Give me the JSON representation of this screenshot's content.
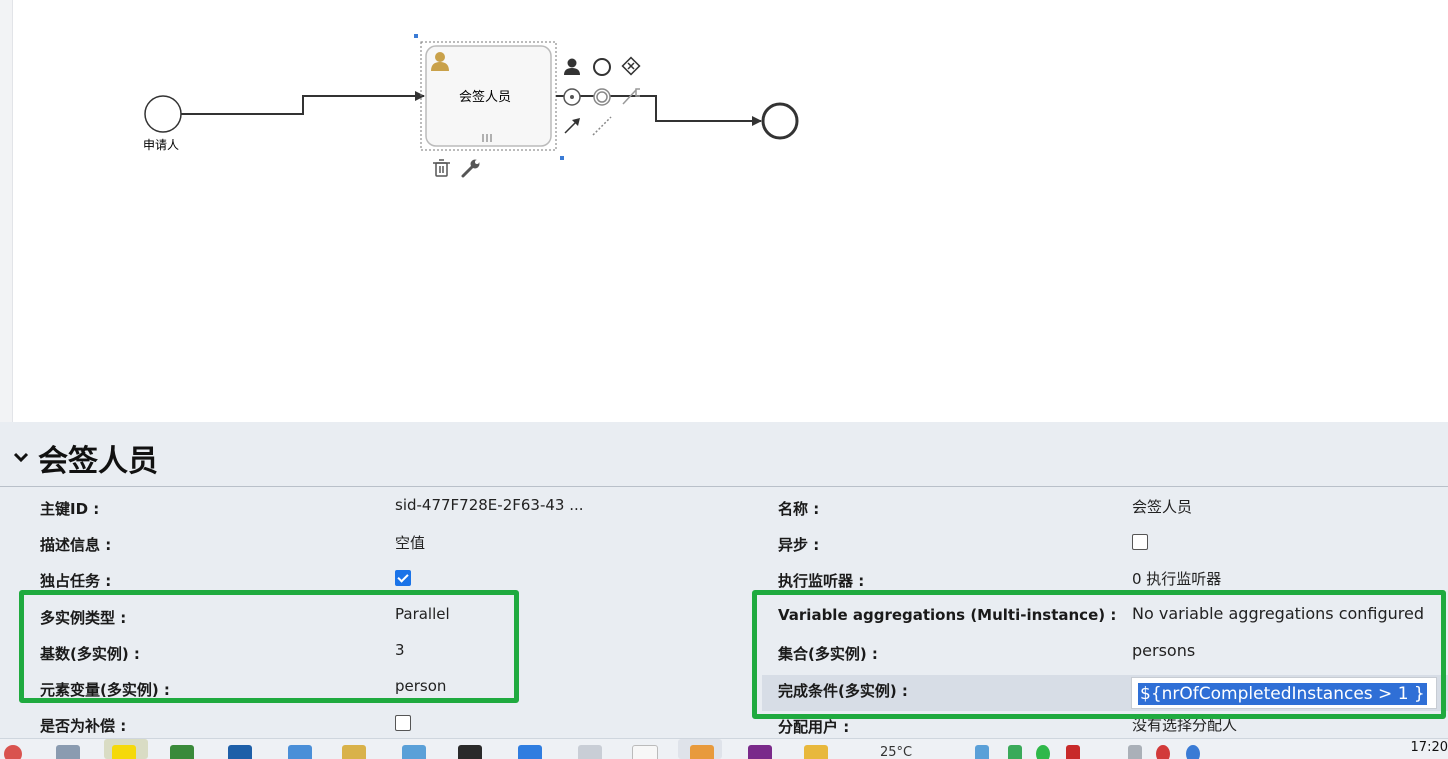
{
  "diagram": {
    "start_label": "申请人",
    "task_label": "会签人员"
  },
  "props": {
    "title": "会签人员",
    "left": [
      {
        "label": "主键ID :",
        "value": "sid-477F728E-2F63-43 ..."
      },
      {
        "label": "描述信息 :",
        "value": "空值"
      },
      {
        "label": "独占任务 :",
        "checked": true
      },
      {
        "label": "多实例类型 :",
        "value": "Parallel"
      },
      {
        "label": "基数(多实例) :",
        "value": "3"
      },
      {
        "label": "元素变量(多实例) :",
        "value": "person"
      },
      {
        "label": "是否为补偿 :",
        "checked": false
      }
    ],
    "right": [
      {
        "label": "名称 :",
        "value": "会签人员"
      },
      {
        "label": "异步 :",
        "checked": false
      },
      {
        "label": "执行监听器 :",
        "value": "0 执行监听器"
      },
      {
        "label": "Variable aggregations (Multi-instance) :",
        "value": "No variable aggregations configured"
      },
      {
        "label": "集合(多实例) :",
        "value": "persons"
      },
      {
        "label": "完成条件(多实例) :",
        "value": "${nrOfCompletedInstances > 1 }"
      },
      {
        "label": "分配用户 :",
        "value": "没有选择分配人"
      }
    ]
  },
  "taskbar": {
    "weather": "25°C",
    "time": "17:20"
  },
  "colors": {
    "highlight_box": "#1faa3f",
    "selection": "#2f6fd6",
    "panel_bg": "#e9edf2"
  }
}
